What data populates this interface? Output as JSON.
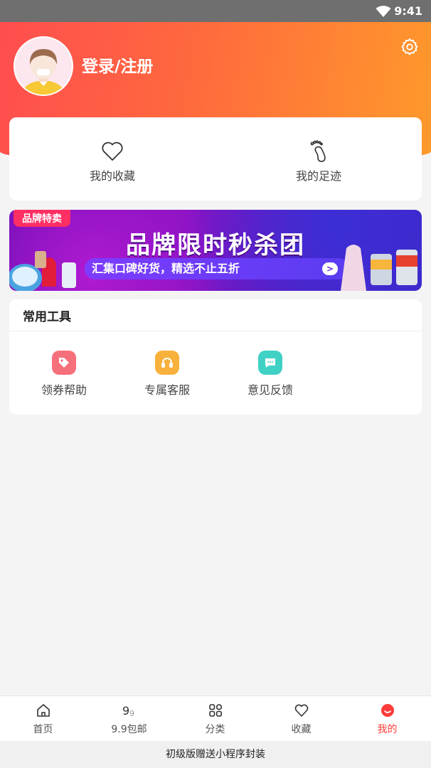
{
  "status": {
    "time": "9:41",
    "wifi_icon": "wifi-icon"
  },
  "profile": {
    "login_label": "登录/注册",
    "avatar": "avatar",
    "settings_icon": "gear-icon"
  },
  "quick": [
    {
      "label": "我的收藏",
      "icon": "heart-icon"
    },
    {
      "label": "我的足迹",
      "icon": "footprint-icon"
    }
  ],
  "banner": {
    "tag": "品牌特卖",
    "title": "品牌限时秒杀团",
    "subtitle": "汇集口碑好货，精选不止五折",
    "arrow": ">"
  },
  "tools": {
    "title": "常用工具",
    "items": [
      {
        "label": "领券帮助",
        "icon": "coupon-tag-icon",
        "color": "#f5707a"
      },
      {
        "label": "专属客服",
        "icon": "headset-icon",
        "color": "#f7b13c"
      },
      {
        "label": "意见反馈",
        "icon": "chat-bubble-icon",
        "color": "#3fd1c4"
      }
    ]
  },
  "tabbar": [
    {
      "label": "首页",
      "icon": "home-icon"
    },
    {
      "label": "9.9包邮",
      "icon": "nine-nine-icon"
    },
    {
      "label": "分类",
      "icon": "category-grid-icon"
    },
    {
      "label": "收藏",
      "icon": "heart-icon"
    },
    {
      "label": "我的",
      "icon": "profile-face-icon",
      "active": true
    }
  ],
  "footer": "初级版赠送小程序封装",
  "colors": {
    "accent": "#ff3b3b",
    "header_start": "#ff4d4f",
    "header_end": "#ff9a2b"
  }
}
